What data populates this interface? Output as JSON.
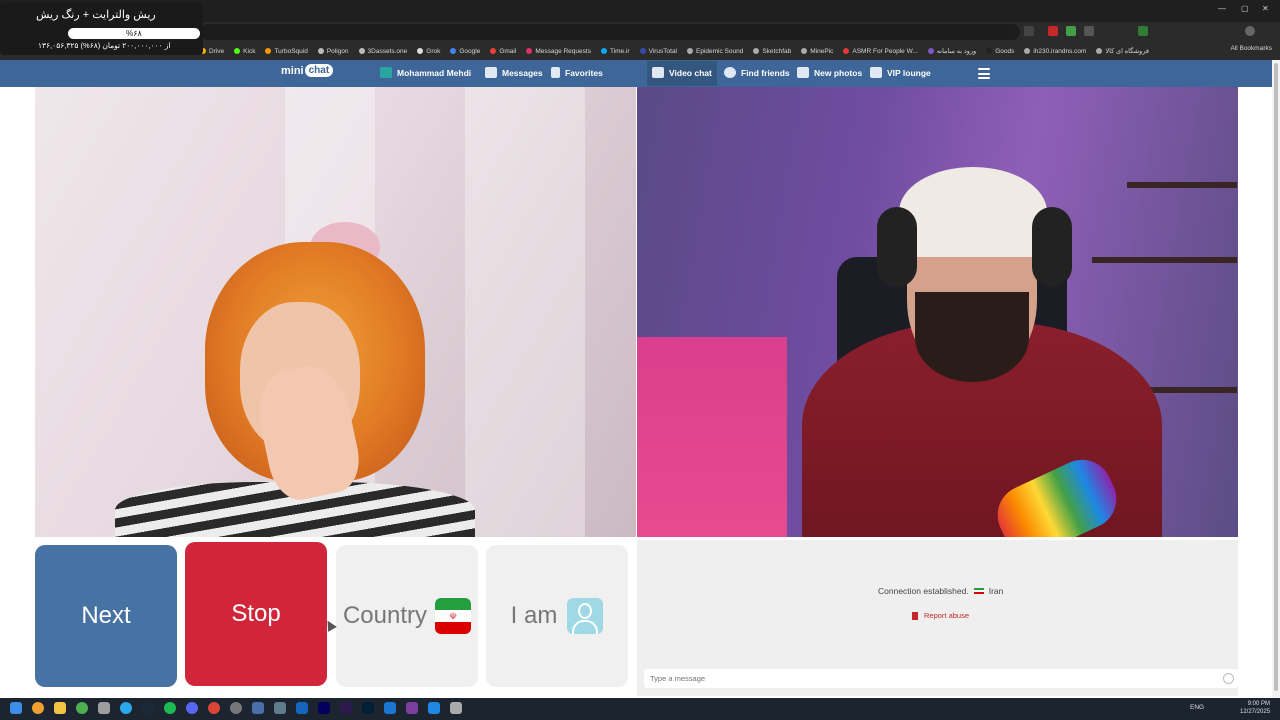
{
  "overlay": {
    "title": "ریش والترایت + رنگ ریش",
    "progress_label": "%۶۸",
    "progress_value": 0.68,
    "price_line": "۱۳۶,۰۵۶,۳۲۵ از ۲۰۰,۰۰۰,۰۰۰ تومان (۶۸%)"
  },
  "browser": {
    "bookmarks": [
      "Drive",
      "Kick",
      "TurboSquid",
      "Poligon",
      "3Dassets.one",
      "Grok",
      "Google",
      "Gmail",
      "Message Requests",
      "Time.ir",
      "VirusTotal",
      "Epidemic Sound",
      "Sketchfab",
      "MinePic",
      "ASMR For People W...",
      "ورود به سامانه",
      "Goods",
      "ih230.irandns.com",
      "فروشگاه ای کالا"
    ],
    "all_bookmarks": "All Bookmarks"
  },
  "site": {
    "logo_mini": "mini",
    "logo_chat": "chat",
    "nav": {
      "user": "Mohammad Mehdi",
      "messages": "Messages",
      "favorites": "Favorites",
      "video_chat": "Video chat",
      "find_friends": "Find friends",
      "new_photos": "New photos",
      "vip_lounge": "VIP lounge"
    }
  },
  "controls": {
    "next": "Next",
    "stop": "Stop",
    "country": "Country",
    "iam": "I am"
  },
  "chat": {
    "connection_text": "Connection established.",
    "country": "Iran",
    "report": "Report abuse",
    "input_placeholder": "Type a message"
  },
  "taskbar": {
    "lang": "ENG",
    "time": "9:00 PM",
    "date": "12/27/2025"
  },
  "colors": {
    "site_header": "#3f6698",
    "next_button": "#4672a4",
    "stop_button": "#d1263a",
    "option_button": "#f0f0f0",
    "report_red": "#c62828"
  }
}
